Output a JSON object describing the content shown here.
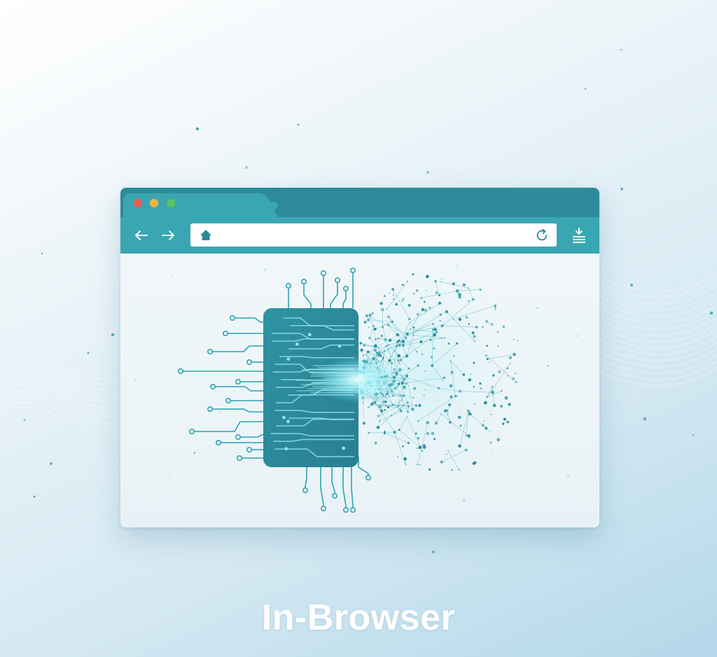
{
  "caption": "In-Browser",
  "browser": {
    "tabs": [
      {
        "label": "",
        "active": true
      }
    ],
    "address_bar": {
      "value": "",
      "placeholder": ""
    },
    "icons": {
      "back": "arrow-left-icon",
      "forward": "arrow-right-icon",
      "home": "home-icon",
      "reload": "reload-icon",
      "menu": "download-menu-icon"
    }
  },
  "illustration": {
    "left_element": "circuit-chip",
    "right_element": "neural-network-sphere"
  },
  "colors": {
    "tab_strip": "#2e8a9a",
    "toolbar": "#3aa6b2",
    "accent": "#2aa3b4",
    "chip": "#2f8e9e",
    "close": "#ee5a4f",
    "minimize": "#f2b640",
    "maximize": "#5cc25c",
    "caption": "#ffffff"
  }
}
